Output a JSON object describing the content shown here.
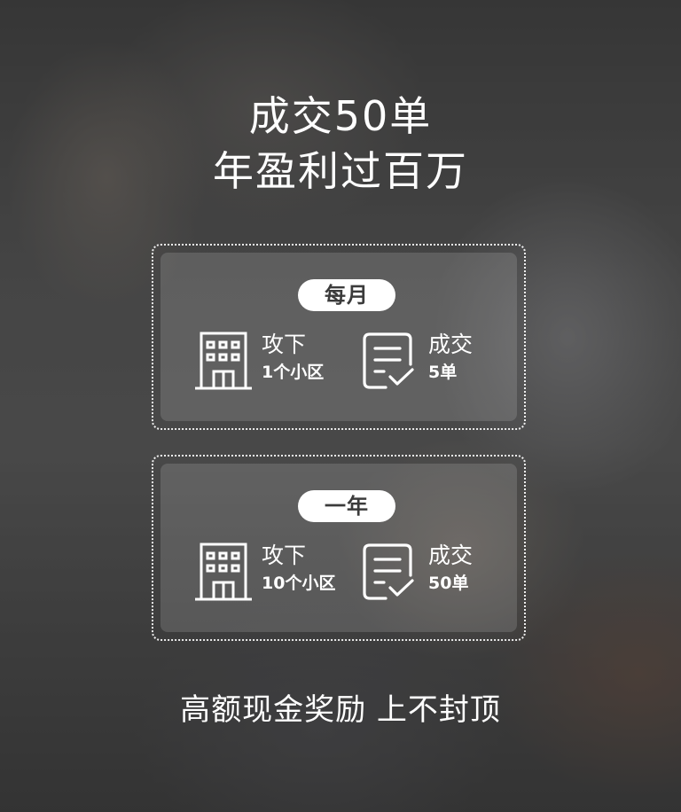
{
  "headline": {
    "line1": "成交50单",
    "line2": "年盈利过百万"
  },
  "cards": [
    {
      "pill": "每月",
      "left": {
        "title": "攻下",
        "value": "1个小区",
        "icon": "building-icon"
      },
      "right": {
        "title": "成交",
        "value": "5单",
        "icon": "document-check-icon"
      }
    },
    {
      "pill": "一年",
      "left": {
        "title": "攻下",
        "value": "10个小区",
        "icon": "building-icon"
      },
      "right": {
        "title": "成交",
        "value": "50单",
        "icon": "document-check-icon"
      }
    }
  ],
  "footer": "高额现金奖励 上不封顶",
  "colors": {
    "text": "#ffffff",
    "pill_bg": "#ffffff",
    "pill_text": "#3b3b3b",
    "overlay": "#4a4a4a"
  }
}
